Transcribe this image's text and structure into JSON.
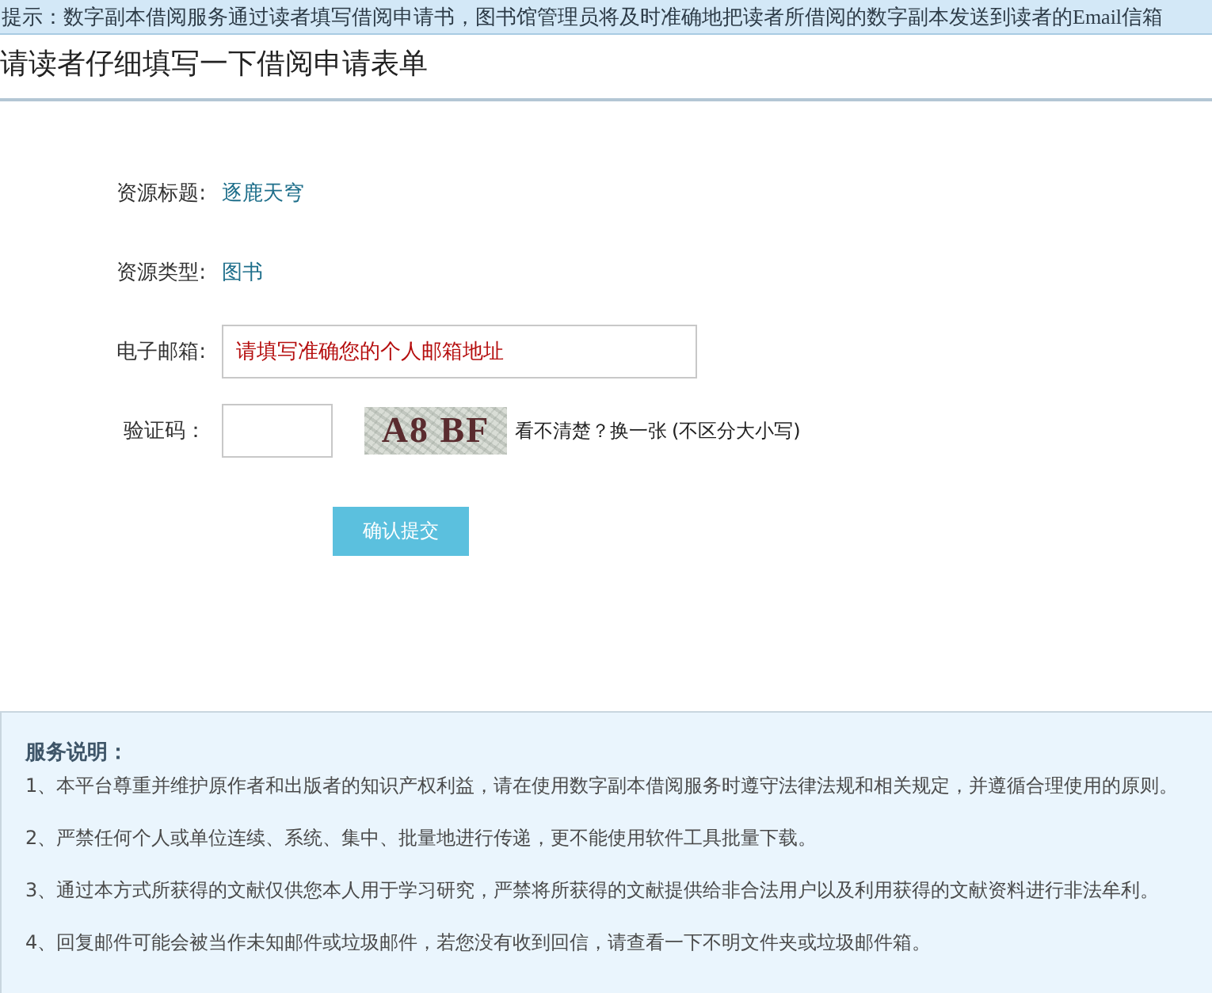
{
  "notice": {
    "text": "提示：数字副本借阅服务通过读者填写借阅申请书，图书馆管理员将及时准确地把读者所借阅的数字副本发送到读者的Email信箱"
  },
  "page_title": "请读者仔细填写一下借阅申请表单",
  "form": {
    "fields": [
      {
        "kind": "text",
        "label": "资源标题:",
        "value": "逐鹿天穹"
      },
      {
        "kind": "text",
        "label": "资源类型:",
        "value": "图书"
      },
      {
        "kind": "input",
        "label": "电子邮箱:",
        "placeholder": "请填写准确您的个人邮箱地址"
      },
      {
        "kind": "captcha",
        "label": "验证码：",
        "captcha_code": "A8 BF",
        "refresh_link": "看不清楚？换一张",
        "hint": "(不区分大小写)"
      }
    ],
    "submit_button": "确认提交"
  },
  "service_notes": {
    "title": "服务说明：",
    "items": [
      "1、本平台尊重并维护原作者和出版者的知识产权利益，请在使用数字副本借阅服务时遵守法律法规和相关规定，并遵循合理使用的原则。",
      "2、严禁任何个人或单位连续、系统、集中、批量地进行传递，更不能使用软件工具批量下载。",
      "3、通过本方式所获得的文献仅供您本人用于学习研究，严禁将所获得的文献提供给非合法用户以及利用获得的文献资料进行非法牟利。",
      "4、回复邮件可能会被当作未知邮件或垃圾邮件，若您没有收到回信，请查看一下不明文件夹或垃圾邮件箱。"
    ]
  }
}
